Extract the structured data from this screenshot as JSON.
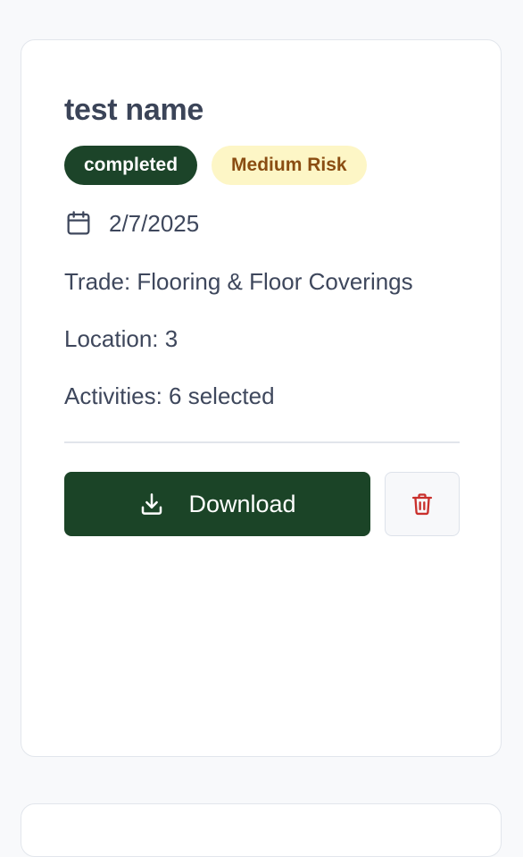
{
  "card": {
    "title": "test name",
    "status_badge": "completed",
    "risk_badge": "Medium Risk",
    "date": "2/7/2025",
    "trade": "Trade: Flooring & Floor Coverings",
    "location": "Location: 3",
    "activities": "Activities: 6 selected",
    "download_label": "Download"
  },
  "icons": {
    "date": "calendar-icon",
    "download": "download-icon",
    "delete": "trash-icon"
  },
  "colors": {
    "status_badge_bg": "#1c4429",
    "risk_badge_bg": "#fdf6c6",
    "risk_badge_text": "#8a4d12",
    "download_button_bg": "#1b4427",
    "delete_icon": "#c9302c"
  }
}
